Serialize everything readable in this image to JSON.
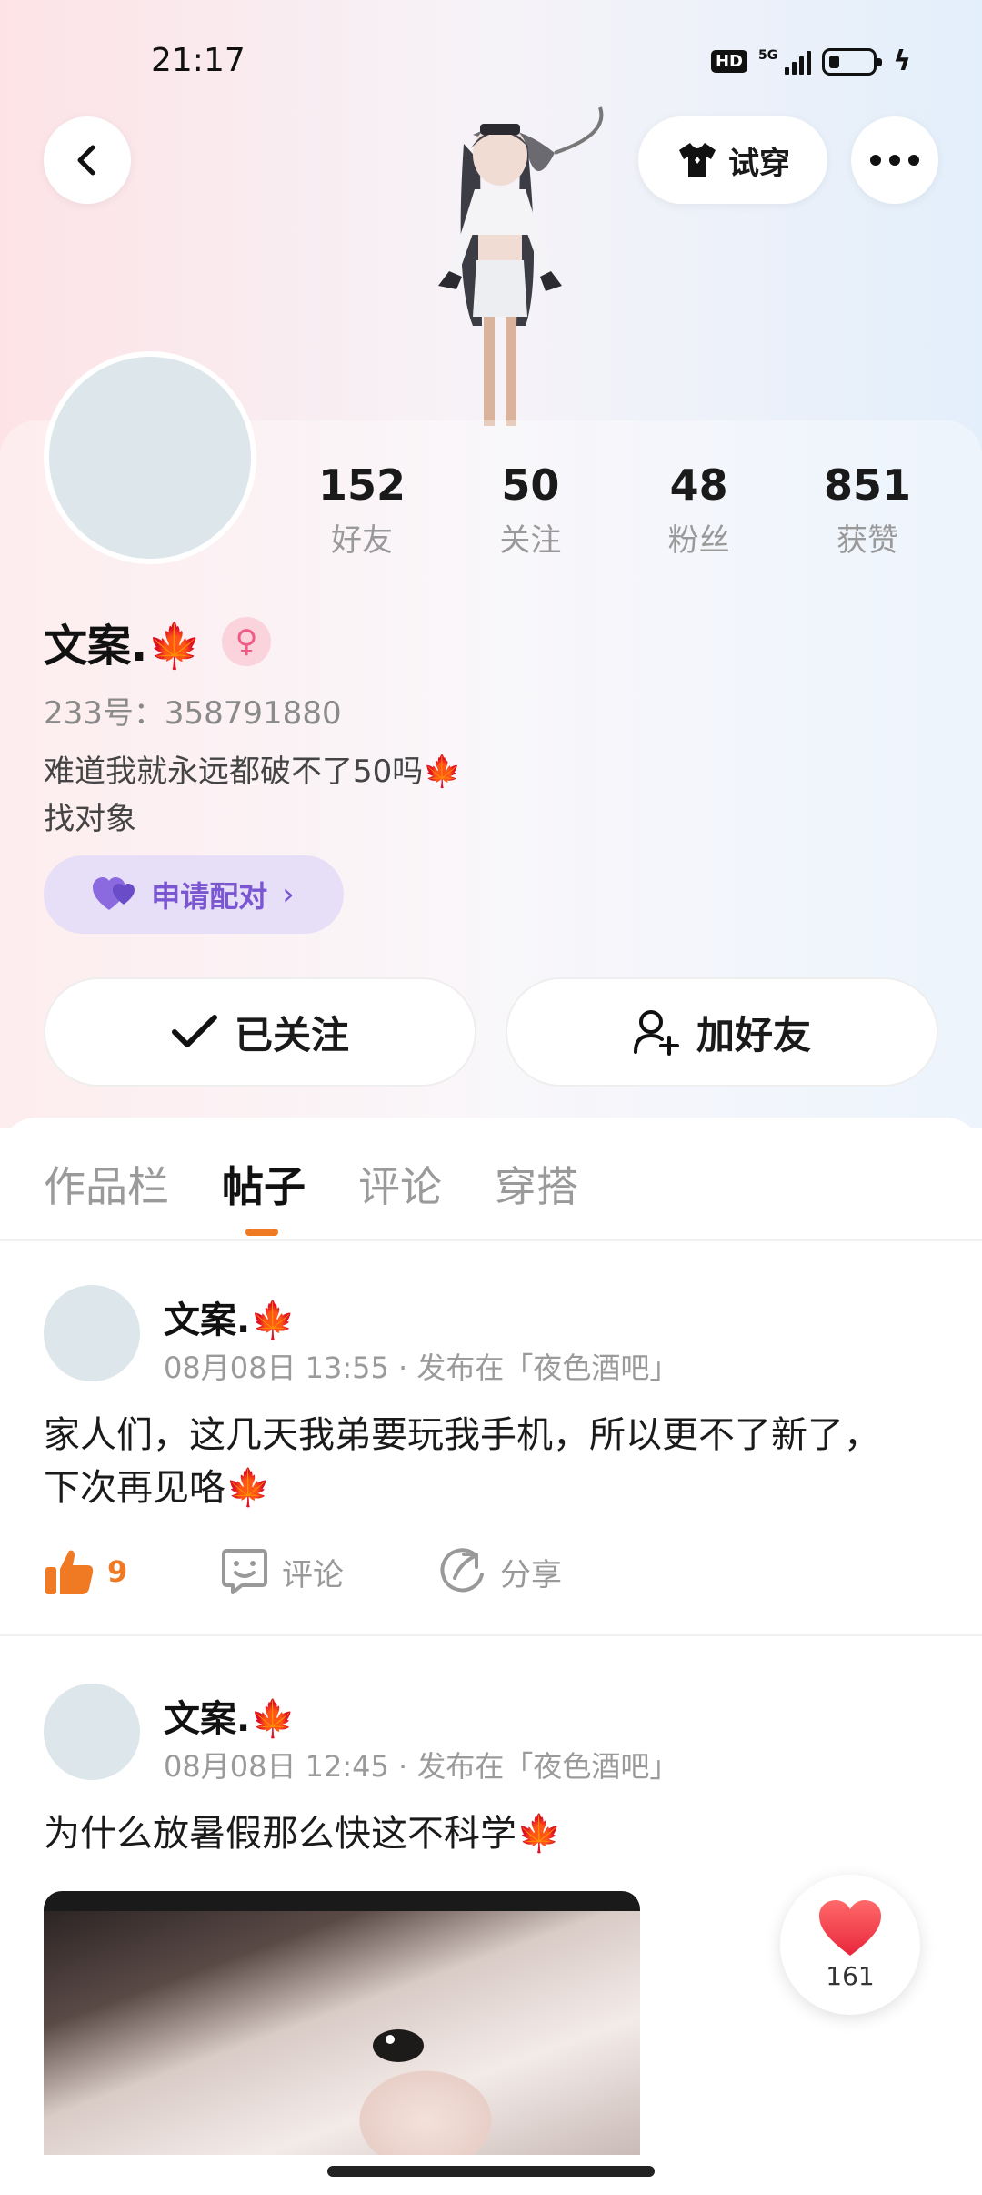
{
  "status_bar": {
    "time": "21:17",
    "hd": "HD",
    "network": "5G",
    "icons": [
      "hd-icon",
      "signal-icon",
      "battery-icon",
      "charging-icon"
    ]
  },
  "header": {
    "back_icon": "chevron-left-icon",
    "tryon_label": "试穿",
    "tryon_icon": "shirt-icon",
    "more_icon": "ellipsis-icon"
  },
  "profile": {
    "stats": [
      {
        "value": "152",
        "label": "好友"
      },
      {
        "value": "50",
        "label": "关注"
      },
      {
        "value": "48",
        "label": "粉丝"
      },
      {
        "value": "851",
        "label": "获赞"
      }
    ],
    "nickname": "文案.🍁",
    "gender_symbol": "♀",
    "uid": "233号：358791880",
    "bio_line1": "难道我就永远都破不了50吗🍁",
    "bio_line2": "找对象",
    "match_label": "申请配对",
    "follow_label": "已关注",
    "add_friend_label": "加好友"
  },
  "tabs": [
    {
      "label": "作品栏",
      "active": false
    },
    {
      "label": "帖子",
      "active": true
    },
    {
      "label": "评论",
      "active": false
    },
    {
      "label": "穿搭",
      "active": false
    }
  ],
  "posts": [
    {
      "author": "文案.🍁",
      "meta": "08月08日 13:55 · 发布在「夜色酒吧」",
      "text_line1": "家人们，这几天我弟要玩我手机，所以更不了新了，",
      "text_line2": "下次再见咯🍁",
      "likes": "9",
      "comment_label": "评论",
      "share_label": "分享"
    },
    {
      "author": "文案.🍁",
      "meta": "08月08日 12:45 · 发布在「夜色酒吧」",
      "text_line1": "为什么放暑假那么快这不科学🍁"
    }
  ],
  "floating_like": {
    "count": "161"
  },
  "colors": {
    "accent": "#f07a24",
    "match_purple": "#7a57d1",
    "like_red": "#f2404f"
  }
}
